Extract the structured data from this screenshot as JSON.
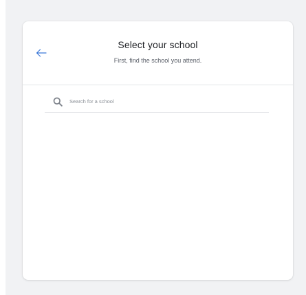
{
  "header": {
    "title": "Select your school",
    "subtitle": "First, find the school you attend.",
    "back_icon": "arrow-left-icon"
  },
  "search": {
    "placeholder": "Search for a school",
    "value": "",
    "icon": "search-icon"
  },
  "colors": {
    "accent": "#3b78d8",
    "title_text": "#1d1f23",
    "subtitle_text": "#5b6069",
    "backdrop": "#f1f2f4",
    "icon_gray": "#7d828a"
  }
}
